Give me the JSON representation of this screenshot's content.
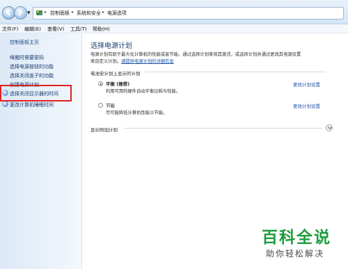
{
  "breadcrumb": [
    "控制面板",
    "系统和安全",
    "电源选项"
  ],
  "menubar": {
    "items": [
      "文件(F)",
      "编辑(E)",
      "查看(V)",
      "工具(T)",
      "帮助(H)"
    ]
  },
  "sidebar": {
    "home": "控制面板主页",
    "items": [
      "唤醒时需要密码",
      "选择电源按钮的功能",
      "选择关闭盖子的功能",
      "创建电源计划",
      "选择关闭显示器的时间",
      "更改计算机睡眠时间"
    ]
  },
  "main": {
    "title": "选择电源计划",
    "desc_line1": "电源计划有助于最大化计算机的性能或者节能。通过选择计划来将其激活，或选择计划并通过更改其电源设置",
    "desc_line2_prefix": "来自定义计划。",
    "desc_link": "请提供电源计划的详细信息",
    "section_label": "电池安计划上显示的计划",
    "plans": [
      {
        "name": "平衡 (推荐)",
        "desc": "利用可用的硬件自动平衡功耗与性能。",
        "link": "更改计划设置",
        "selected": true
      },
      {
        "name": "节能",
        "desc": "尽可能降低计算机性能以节能。",
        "link": "更改计划设置",
        "selected": false
      }
    ],
    "extra_label": "显示附加计划"
  },
  "watermark": {
    "title": "百科全说",
    "subtitle": "助你轻松解决"
  },
  "colors": {
    "highlight_border": "#e02020",
    "link": "#1d55a8",
    "watermark_green": "#1e9c3c"
  }
}
